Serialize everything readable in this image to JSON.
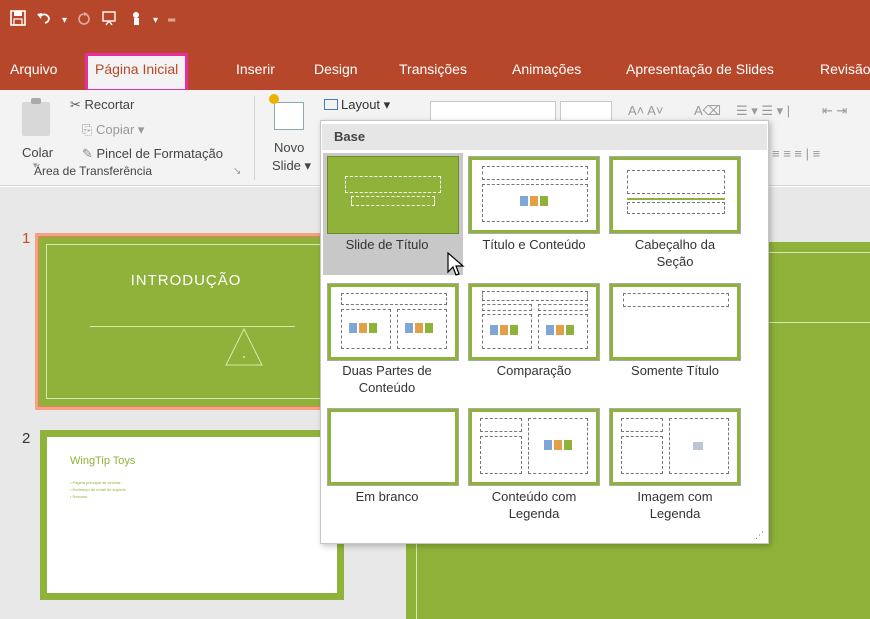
{
  "qat": {
    "save_icon": "save-icon",
    "undo_icon": "undo-icon",
    "undo_arrow": "▾",
    "redo_icon": "redo-icon",
    "present_icon": "from-beginning-icon",
    "customize_icon": "customize-icon"
  },
  "tabs": {
    "arquivo": "Arquivo",
    "pagina_inicial": "Página Inicial",
    "inserir": "Inserir",
    "design": "Design",
    "transicoes": "Transições",
    "animacoes": "Animações",
    "apresentacao": "Apresentação de Slides",
    "revisao": "Revisão"
  },
  "ribbon": {
    "colar": "Colar",
    "recortar": "Recortar",
    "copiar": "Copiar",
    "pincel": "Pincel de Formatação",
    "area_transferencia": "Área de Transferência",
    "novo": "Novo",
    "slide": "Slide",
    "layout": "Layout",
    "dropdown_caret": "▾"
  },
  "slides": {
    "s1_num": "1",
    "s1_title": "INTRODUÇÃO",
    "s2_num": "2",
    "s2_title": "WingTip Toys",
    "s2_bullets": [
      "• Página principal de vendas",
      "• Endereço de email de suporte",
      "• Resumo"
    ]
  },
  "layout_menu": {
    "header": "Base",
    "items": [
      {
        "label_1": "Slide de Título",
        "label_2": ""
      },
      {
        "label_1": "Título e Conteúdo",
        "label_2": ""
      },
      {
        "label_1": "Cabeçalho da",
        "label_2": "Seção"
      },
      {
        "label_1": "Duas Partes de",
        "label_2": "Conteúdo"
      },
      {
        "label_1": "Comparação",
        "label_2": ""
      },
      {
        "label_1": "Somente Título",
        "label_2": ""
      },
      {
        "label_1": "Em branco",
        "label_2": ""
      },
      {
        "label_1": "Conteúdo com",
        "label_2": "Legenda"
      },
      {
        "label_1": "Imagem com",
        "label_2": "Legenda"
      }
    ],
    "selected_index": 0
  },
  "colors": {
    "titlebar": "#b7472a",
    "accent_green": "#8fb33a",
    "active_tab_highlight": "#e52fa0"
  }
}
